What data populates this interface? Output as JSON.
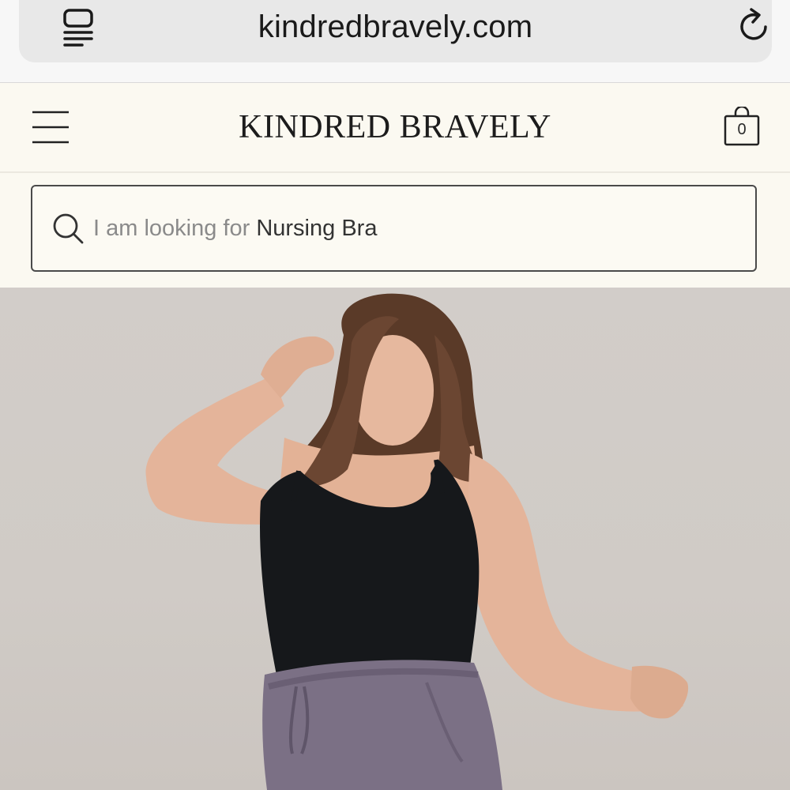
{
  "browser": {
    "url": "kindredbravely.com",
    "reader_icon": "reader-mode-icon",
    "reload_icon": "reload-icon"
  },
  "header": {
    "menu_icon": "hamburger-menu-icon",
    "brand": "KINDRED BRAVELY",
    "cart_icon": "shopping-bag-icon",
    "cart_count": "0"
  },
  "search": {
    "icon": "search-icon",
    "prefix": "I am looking for",
    "term": "Nursing Bra"
  },
  "hero": {
    "image": "model-wearing-black-nursing-cami-and-purple-joggers"
  },
  "colors": {
    "header_bg": "#fbf9f1",
    "hero_bg": "#d0cbc6",
    "text": "#1c1c1c"
  }
}
